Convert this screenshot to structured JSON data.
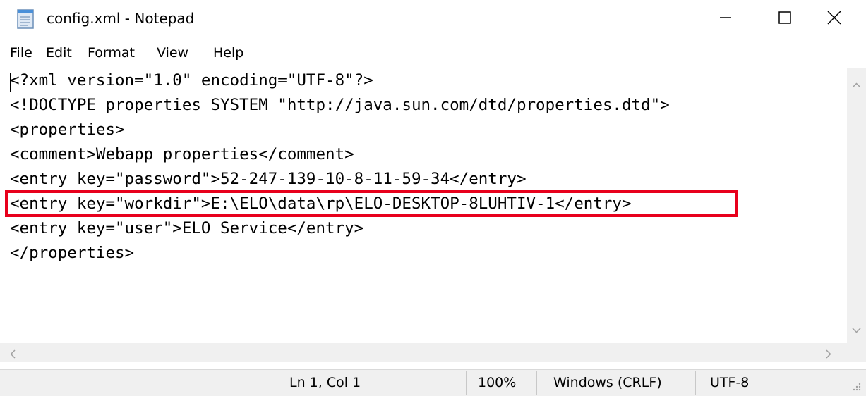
{
  "window": {
    "title": "config.xml - Notepad",
    "icon": "notepad-icon",
    "controls": [
      "minimize-icon",
      "maximize-icon",
      "close-icon"
    ]
  },
  "menu": {
    "items": [
      "File",
      "Edit",
      "Format",
      "View",
      "Help"
    ]
  },
  "editor": {
    "lines": [
      "<?xml version=\"1.0\" encoding=\"UTF-8\"?>",
      "<!DOCTYPE properties SYSTEM \"http://java.sun.com/dtd/properties.dtd\">",
      "<properties>",
      "<comment>Webapp properties</comment>",
      "<entry key=\"password\">52-247-139-10-8-11-59-34</entry>",
      "<entry key=\"workdir\">E:\\ELO\\data\\rp\\ELO-DESKTOP-8LUHTIV-1</entry>",
      "<entry key=\"user\">ELO Service</entry>",
      "</properties>"
    ],
    "highlight_color": "#e8001c"
  },
  "status": {
    "position": "Ln 1, Col 1",
    "zoom": "100%",
    "line_ending": "Windows (CRLF)",
    "encoding": "UTF-8"
  }
}
